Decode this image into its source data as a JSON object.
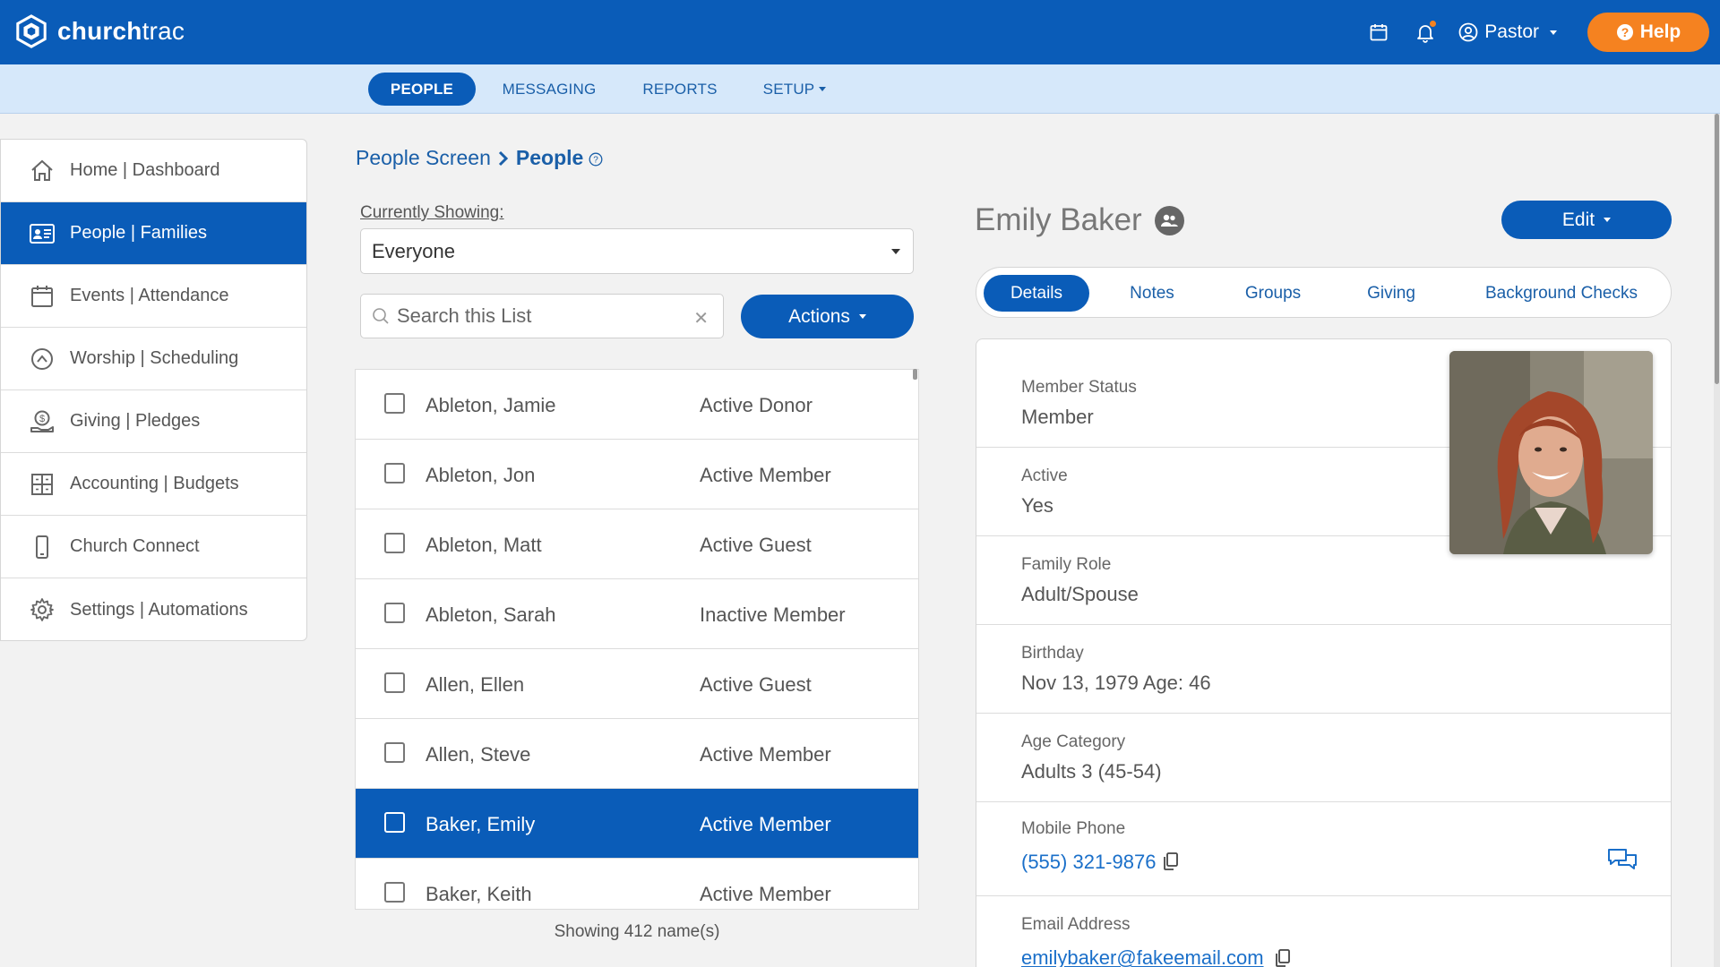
{
  "app": {
    "logo_text_bold": "church",
    "logo_text_light": "trac",
    "user_label": "Pastor",
    "help_label": "Help"
  },
  "nav": {
    "tabs": [
      {
        "label": "PEOPLE",
        "active": true
      },
      {
        "label": "MESSAGING"
      },
      {
        "label": "REPORTS"
      },
      {
        "label": "SETUP"
      }
    ]
  },
  "sidebar": {
    "items": [
      {
        "label": "Home | Dashboard",
        "icon": "home-icon"
      },
      {
        "label": "People | Families",
        "icon": "id-card-icon",
        "active": true
      },
      {
        "label": "Events | Attendance",
        "icon": "calendar-icon"
      },
      {
        "label": "Worship | Scheduling",
        "icon": "worship-icon"
      },
      {
        "label": "Giving | Pledges",
        "icon": "giving-icon"
      },
      {
        "label": "Accounting | Budgets",
        "icon": "grid-icon"
      },
      {
        "label": "Church Connect",
        "icon": "phone-icon"
      },
      {
        "label": "Settings | Automations",
        "icon": "gear-icon"
      }
    ]
  },
  "breadcrumb": {
    "parent": "People Screen",
    "current": "People"
  },
  "list_panel": {
    "showing_label": "Currently Showing:",
    "showing_value": "Everyone",
    "search_placeholder": "Search this List",
    "actions_label": "Actions",
    "rows": [
      {
        "name": "Ableton, Jamie",
        "status": "Active Donor"
      },
      {
        "name": "Ableton, Jon",
        "status": "Active Member"
      },
      {
        "name": "Ableton, Matt",
        "status": "Active Guest"
      },
      {
        "name": "Ableton, Sarah",
        "status": "Inactive Member"
      },
      {
        "name": "Allen, Ellen",
        "status": "Active Guest"
      },
      {
        "name": "Allen, Steve",
        "status": "Active Member"
      },
      {
        "name": "Baker, Emily",
        "status": "Active Member",
        "selected": true
      },
      {
        "name": "Baker, Keith",
        "status": "Active Member"
      }
    ],
    "footer": "Showing 412 name(s)"
  },
  "profile": {
    "name": "Emily Baker",
    "edit_label": "Edit",
    "tabs": [
      {
        "label": "Details",
        "active": true
      },
      {
        "label": "Notes"
      },
      {
        "label": "Groups"
      },
      {
        "label": "Giving"
      },
      {
        "label": "Background Checks"
      }
    ],
    "fields": [
      {
        "label": "Member Status",
        "value": "Member"
      },
      {
        "label": "Active",
        "value": "Yes"
      },
      {
        "label": "Family Role",
        "value": "Adult/Spouse"
      },
      {
        "label": "Birthday",
        "value": "Nov 13, 1979 Age: 46"
      },
      {
        "label": "Age Category",
        "value": "Adults 3 (45-54)"
      },
      {
        "label": "Mobile Phone",
        "value": "(555) 321-9876"
      },
      {
        "label": "Email Address",
        "value": "emilybaker@fakeemail.com"
      }
    ]
  },
  "colors": {
    "brand_blue": "#0a5cb8",
    "nav_bg": "#d6e8fa",
    "help_orange": "#f58220",
    "link_blue": "#1a6fc9"
  }
}
